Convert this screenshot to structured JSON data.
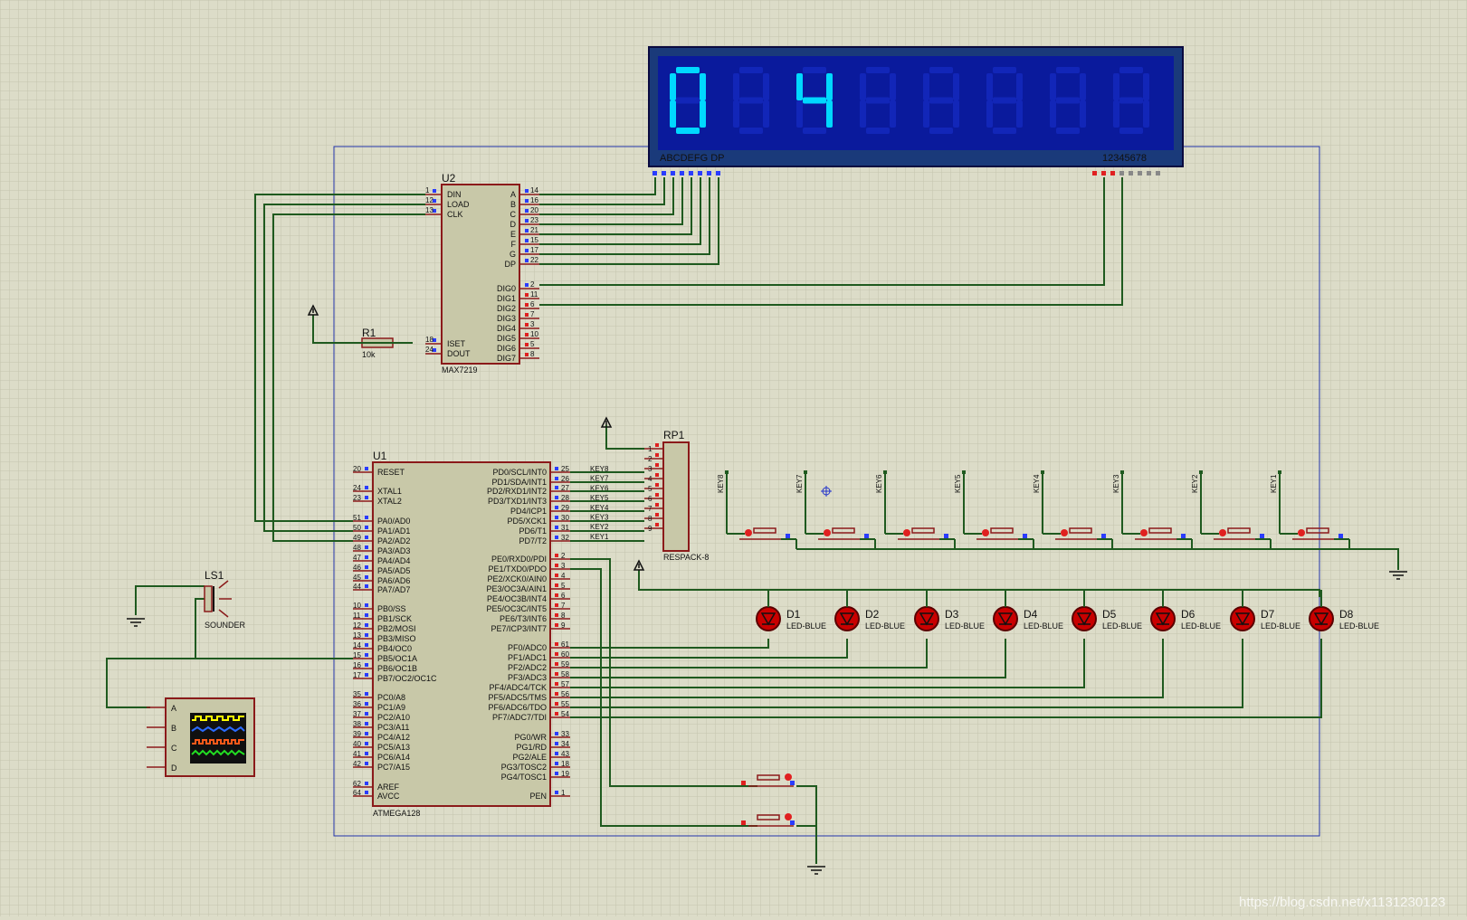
{
  "display": {
    "digits": [
      "0",
      "4"
    ],
    "left_label": "ABCDEFG  DP",
    "right_label": "12345678"
  },
  "u2": {
    "ref": "U2",
    "type": "MAX7219",
    "left_pins": [
      {
        "num": "1",
        "name": "DIN"
      },
      {
        "num": "12",
        "name": "LOAD"
      },
      {
        "num": "13",
        "name": "CLK"
      },
      {
        "num": "18",
        "name": "ISET"
      },
      {
        "num": "24",
        "name": "DOUT"
      }
    ],
    "right_pins": [
      {
        "num": "14",
        "name": "A"
      },
      {
        "num": "16",
        "name": "B"
      },
      {
        "num": "20",
        "name": "C"
      },
      {
        "num": "23",
        "name": "D"
      },
      {
        "num": "21",
        "name": "E"
      },
      {
        "num": "15",
        "name": "F"
      },
      {
        "num": "17",
        "name": "G"
      },
      {
        "num": "22",
        "name": "DP"
      },
      {
        "num": "2",
        "name": "DIG0"
      },
      {
        "num": "11",
        "name": "DIG1"
      },
      {
        "num": "6",
        "name": "DIG2"
      },
      {
        "num": "7",
        "name": "DIG3"
      },
      {
        "num": "3",
        "name": "DIG4"
      },
      {
        "num": "10",
        "name": "DIG5"
      },
      {
        "num": "5",
        "name": "DIG6"
      },
      {
        "num": "8",
        "name": "DIG7"
      }
    ]
  },
  "r1": {
    "ref": "R1",
    "value": "10k"
  },
  "u1": {
    "ref": "U1",
    "type": "ATMEGA128",
    "left_pins": [
      {
        "num": "20",
        "name": "RESET"
      },
      {
        "num": "24",
        "name": "XTAL1"
      },
      {
        "num": "23",
        "name": "XTAL2"
      },
      {
        "num": "51",
        "name": "PA0/AD0"
      },
      {
        "num": "50",
        "name": "PA1/AD1"
      },
      {
        "num": "49",
        "name": "PA2/AD2"
      },
      {
        "num": "48",
        "name": "PA3/AD3"
      },
      {
        "num": "47",
        "name": "PA4/AD4"
      },
      {
        "num": "46",
        "name": "PA5/AD5"
      },
      {
        "num": "45",
        "name": "PA6/AD6"
      },
      {
        "num": "44",
        "name": "PA7/AD7"
      },
      {
        "num": "10",
        "name": "PB0/SS"
      },
      {
        "num": "11",
        "name": "PB1/SCK"
      },
      {
        "num": "12",
        "name": "PB2/MOSI"
      },
      {
        "num": "13",
        "name": "PB3/MISO"
      },
      {
        "num": "14",
        "name": "PB4/OC0"
      },
      {
        "num": "15",
        "name": "PB5/OC1A"
      },
      {
        "num": "16",
        "name": "PB6/OC1B"
      },
      {
        "num": "17",
        "name": "PB7/OC2/OC1C"
      },
      {
        "num": "35",
        "name": "PC0/A8"
      },
      {
        "num": "36",
        "name": "PC1/A9"
      },
      {
        "num": "37",
        "name": "PC2/A10"
      },
      {
        "num": "38",
        "name": "PC3/A11"
      },
      {
        "num": "39",
        "name": "PC4/A12"
      },
      {
        "num": "40",
        "name": "PC5/A13"
      },
      {
        "num": "41",
        "name": "PC6/A14"
      },
      {
        "num": "42",
        "name": "PC7/A15"
      },
      {
        "num": "62",
        "name": "AREF"
      },
      {
        "num": "64",
        "name": "AVCC"
      }
    ],
    "right_pins": [
      {
        "num": "25",
        "name": "PD0/SCL/INT0"
      },
      {
        "num": "26",
        "name": "PD1/SDA/INT1"
      },
      {
        "num": "27",
        "name": "PD2/RXD1/INT2"
      },
      {
        "num": "28",
        "name": "PD3/TXD1/INT3"
      },
      {
        "num": "29",
        "name": "PD4/ICP1"
      },
      {
        "num": "30",
        "name": "PD5/XCK1"
      },
      {
        "num": "31",
        "name": "PD6/T1"
      },
      {
        "num": "32",
        "name": "PD7/T2"
      },
      {
        "num": "2",
        "name": "PE0/RXD0/PDI"
      },
      {
        "num": "3",
        "name": "PE1/TXD0/PDO"
      },
      {
        "num": "4",
        "name": "PE2/XCK0/AIN0"
      },
      {
        "num": "5",
        "name": "PE3/OC3A/AIN1"
      },
      {
        "num": "6",
        "name": "PE4/OC3B/INT4"
      },
      {
        "num": "7",
        "name": "PE5/OC3C/INT5"
      },
      {
        "num": "8",
        "name": "PE6/T3/INT6"
      },
      {
        "num": "9",
        "name": "PE7/ICP3/INT7"
      },
      {
        "num": "61",
        "name": "PF0/ADC0"
      },
      {
        "num": "60",
        "name": "PF1/ADC1"
      },
      {
        "num": "59",
        "name": "PF2/ADC2"
      },
      {
        "num": "58",
        "name": "PF3/ADC3"
      },
      {
        "num": "57",
        "name": "PF4/ADC4/TCK"
      },
      {
        "num": "56",
        "name": "PF5/ADC5/TMS"
      },
      {
        "num": "55",
        "name": "PF6/ADC6/TDO"
      },
      {
        "num": "54",
        "name": "PF7/ADC7/TDI"
      },
      {
        "num": "33",
        "name": "PG0/WR"
      },
      {
        "num": "34",
        "name": "PG1/RD"
      },
      {
        "num": "43",
        "name": "PG2/ALE"
      },
      {
        "num": "18",
        "name": "PG3/TOSC2"
      },
      {
        "num": "19",
        "name": "PG4/TOSC1"
      },
      {
        "num": "1",
        "name": "PEN"
      }
    ],
    "key_labels": [
      "KEY8",
      "KEY7",
      "KEY6",
      "KEY5",
      "KEY4",
      "KEY3",
      "KEY2",
      "KEY1"
    ]
  },
  "rp1": {
    "ref": "RP1",
    "type": "RESPACK-8",
    "pins": [
      "1",
      "2",
      "3",
      "4",
      "5",
      "6",
      "7",
      "8",
      "9"
    ]
  },
  "keys": [
    "KEY8",
    "KEY7",
    "KEY6",
    "KEY5",
    "KEY4",
    "KEY3",
    "KEY2",
    "KEY1"
  ],
  "leds": [
    {
      "ref": "D1",
      "type": "LED-BLUE"
    },
    {
      "ref": "D2",
      "type": "LED-BLUE"
    },
    {
      "ref": "D3",
      "type": "LED-BLUE"
    },
    {
      "ref": "D4",
      "type": "LED-BLUE"
    },
    {
      "ref": "D5",
      "type": "LED-BLUE"
    },
    {
      "ref": "D6",
      "type": "LED-BLUE"
    },
    {
      "ref": "D7",
      "type": "LED-BLUE"
    },
    {
      "ref": "D8",
      "type": "LED-BLUE"
    }
  ],
  "ls1": {
    "ref": "LS1",
    "type": "SOUNDER"
  },
  "scope": {
    "channels": [
      "A",
      "B",
      "C",
      "D"
    ]
  },
  "watermark": "https://blog.csdn.net/x1131230123",
  "colors": {
    "wire": "#1f5a1f",
    "display_bg": "#0a1a9c",
    "segment_on": "#00d8ff",
    "component_border": "#8b1a1a",
    "grid_bg": "#dcdcc8"
  }
}
